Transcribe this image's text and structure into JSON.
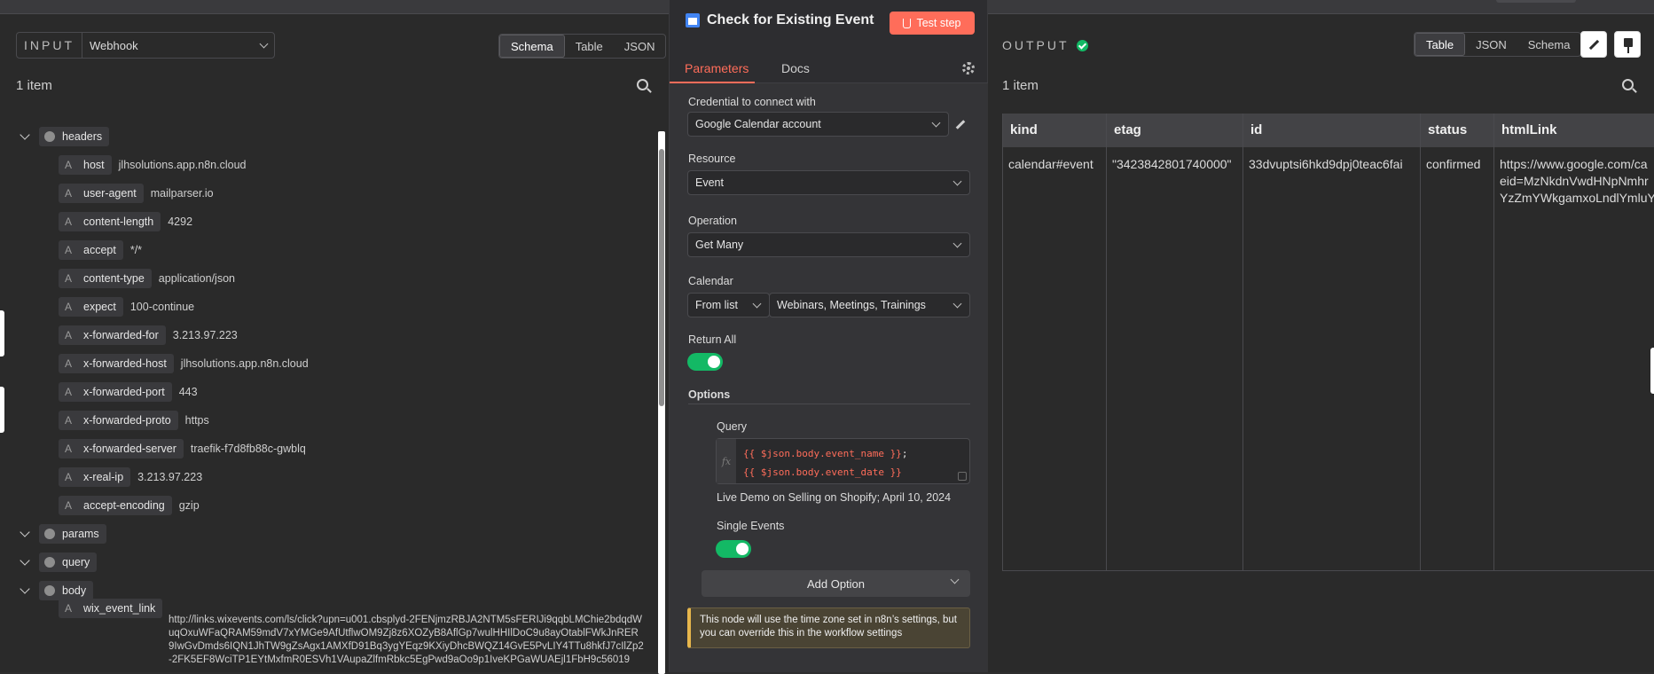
{
  "input": {
    "title": "INPUT",
    "source": "Webhook",
    "views": [
      "Schema",
      "Table",
      "JSON"
    ],
    "active_view": "Schema",
    "count": "1 item",
    "tree": [
      {
        "kind": "object",
        "key": "headers"
      },
      {
        "kind": "field",
        "key": "host",
        "value": "jlhsolutions.app.n8n.cloud"
      },
      {
        "kind": "field",
        "key": "user-agent",
        "value": "mailparser.io"
      },
      {
        "kind": "field",
        "key": "content-length",
        "value": "4292"
      },
      {
        "kind": "field",
        "key": "accept",
        "value": "*/*"
      },
      {
        "kind": "field",
        "key": "content-type",
        "value": "application/json"
      },
      {
        "kind": "field",
        "key": "expect",
        "value": "100-continue"
      },
      {
        "kind": "field",
        "key": "x-forwarded-for",
        "value": "3.213.97.223"
      },
      {
        "kind": "field",
        "key": "x-forwarded-host",
        "value": "jlhsolutions.app.n8n.cloud"
      },
      {
        "kind": "field",
        "key": "x-forwarded-port",
        "value": "443"
      },
      {
        "kind": "field",
        "key": "x-forwarded-proto",
        "value": "https"
      },
      {
        "kind": "field",
        "key": "x-forwarded-server",
        "value": "traefik-f7d8fb88c-gwblq"
      },
      {
        "kind": "field",
        "key": "x-real-ip",
        "value": "3.213.97.223"
      },
      {
        "kind": "field",
        "key": "accept-encoding",
        "value": "gzip"
      },
      {
        "kind": "object",
        "key": "params"
      },
      {
        "kind": "object",
        "key": "query"
      },
      {
        "kind": "object",
        "key": "body"
      }
    ],
    "long_field": {
      "key": "wix_event_link",
      "value": "http://links.wixevents.com/ls/click?upn=u001.cbsplyd-2FENjmzRBJA2NTM5sFERIJi9qqbLMChie2bdqdWuqOxuWFaQRAM59mdV7xYMGe9AfUtflwOM9Zj8z6XOZyB8AflGp7wulHHIlDoC9u8ayOtablFWkJnRER9IwGvDmds6IQN1JhTW9gZsAgx1AMXfD91Bq3ygYEqz9KXiyDhcBWQZ14GvE5PvLIY4TTu8hkfJ7cIlZp2-2FK5EF8WciTP1EYtMxfmR0ESVh1VAupaZlfmRbkc5EgPwd9aOo9p1IveKPGaWUAEjl1FbH9c56019"
    }
  },
  "node": {
    "title": "Check for Existing Event",
    "test_button": "Test step",
    "tabs": [
      "Parameters",
      "Docs"
    ],
    "credential_label": "Credential to connect with",
    "credential_value": "Google Calendar account",
    "resource_label": "Resource",
    "resource_value": "Event",
    "operation_label": "Operation",
    "operation_value": "Get Many",
    "calendar_label": "Calendar",
    "calendar_mode": "From list",
    "calendar_value": "Webinars, Meetings, Trainings",
    "return_all_label": "Return All",
    "return_all": true,
    "options_label": "Options",
    "query_label": "Query",
    "fx": "fx",
    "query_line1": "{{ $json.body.event_name }}",
    "query_line1_suffix": ";",
    "query_line2": "{{ $json.body.event_date }}",
    "query_preview": "Live Demo on Selling on Shopify; April 10, 2024",
    "single_events_label": "Single Events",
    "single_events": true,
    "add_option": "Add Option",
    "notice": "This node will use the time zone set in n8n’s settings, but you can override this in the workflow settings"
  },
  "output": {
    "title": "OUTPUT",
    "views": [
      "Table",
      "JSON",
      "Schema"
    ],
    "active_view": "Table",
    "count": "1 item",
    "columns": [
      "kind",
      "etag",
      "id",
      "status",
      "htmlLink"
    ],
    "row": {
      "kind": "calendar#event",
      "etag": "\"3423842801740000\"",
      "id": "33dvuptsi6hkd9dpj0teac6fai",
      "status": "confirmed",
      "htmlLink_1": "https://www.google.com/ca",
      "htmlLink_2": "eid=MzNkdnVwdHNpNmhr",
      "htmlLink_3": "YzZmYWkgamxoLndlYmluY"
    }
  },
  "colors": {
    "accent": "#ff6d5a",
    "success": "#13b965",
    "notice_border": "#e6b64c"
  }
}
